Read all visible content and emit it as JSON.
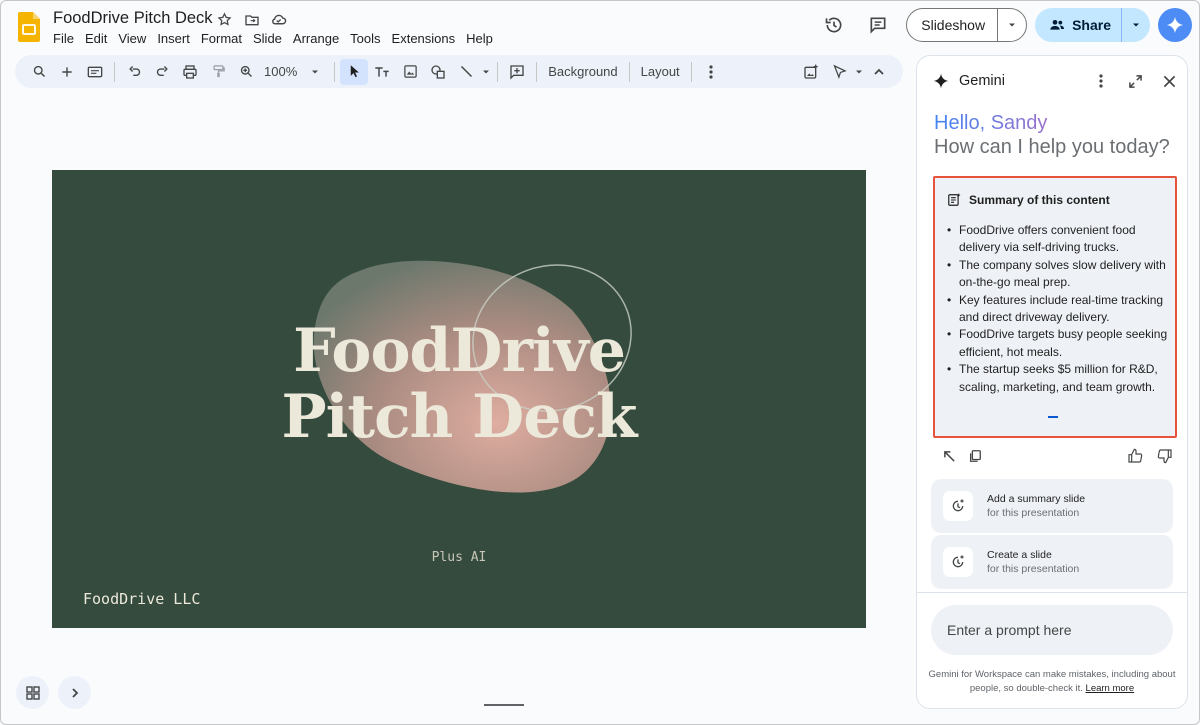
{
  "app": {
    "title": "FoodDrive Pitch Deck",
    "logo_icon": "slides-logo-icon",
    "title_icons": [
      "star-icon",
      "move-to-folder-icon",
      "cloud-saved-icon"
    ]
  },
  "menu": [
    "File",
    "Edit",
    "View",
    "Insert",
    "Format",
    "Slide",
    "Arrange",
    "Tools",
    "Extensions",
    "Help"
  ],
  "header_actions": {
    "history_icon": "history-icon",
    "comments_icon": "comments-icon",
    "slideshow_label": "Slideshow",
    "share_label": "Share",
    "gemini_icon": "gemini-sparkle-icon"
  },
  "toolbar": {
    "zoom": "100%",
    "background_label": "Background",
    "layout_label": "Layout"
  },
  "slide": {
    "title_line1": "FoodDrive",
    "title_line2": "Pitch Deck",
    "subtitle": "Plus AI",
    "company": "FoodDrive LLC",
    "colors": {
      "background": "#344b3d",
      "text": "#ece8da",
      "blob": "#d9a79a"
    }
  },
  "gemini": {
    "panel_title": "Gemini",
    "greeting": "Hello, Sandy",
    "question": "How can I help you today?",
    "summary": {
      "heading": "Summary of this content",
      "bullets": [
        "FoodDrive offers convenient food delivery via self-driving trucks.",
        "The company solves slow delivery with on-the-go meal prep.",
        "Key features include real-time tracking and direct driveway delivery.",
        "FoodDrive targets busy people seeking efficient, hot meals.",
        "The startup seeks $5 million for R&D, scaling, marketing, and team growth."
      ]
    },
    "suggestions": [
      {
        "title": "Add a summary slide",
        "subtitle": "for this presentation"
      },
      {
        "title": "Create a slide",
        "subtitle": "for this presentation"
      }
    ],
    "prompt_placeholder": "Enter a prompt here",
    "disclaimer": "Gemini for Workspace can make mistakes, including about people, so double-check it.",
    "learn_more": "Learn more",
    "accent": "#e5533d"
  }
}
